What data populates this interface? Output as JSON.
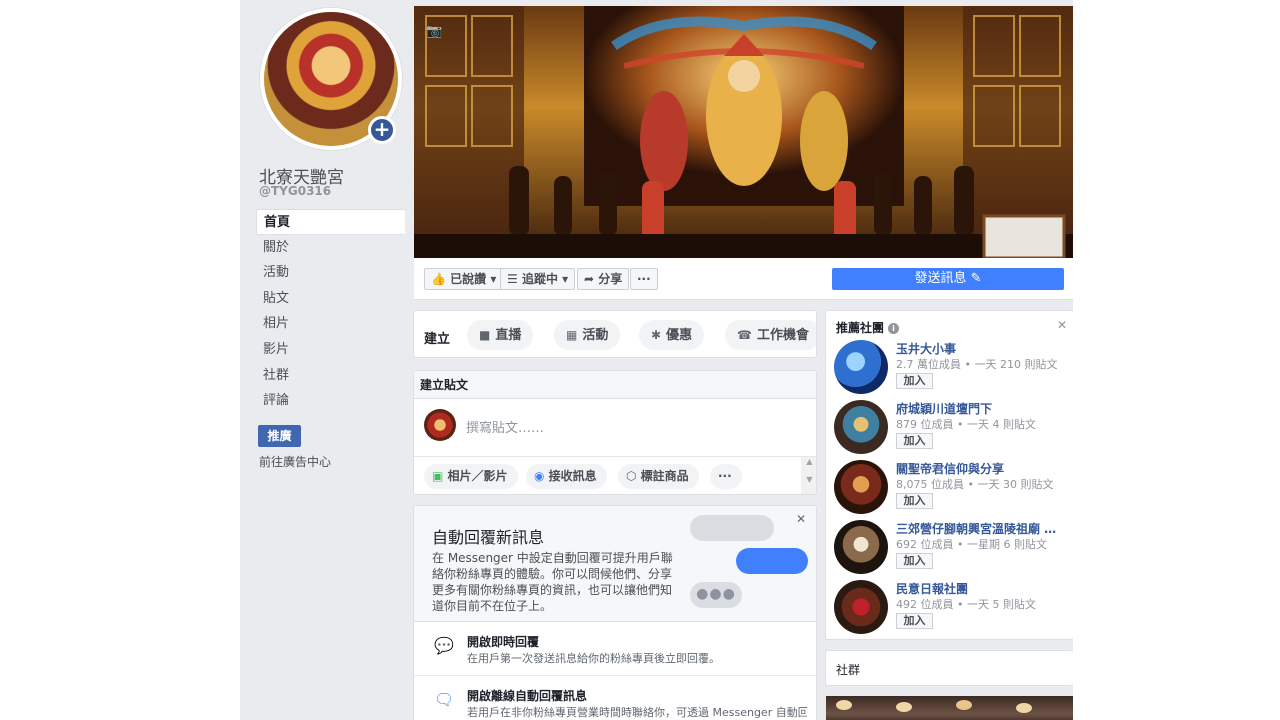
{
  "page": {
    "name": "北寮天艷宮",
    "handle": "@TYG0316"
  },
  "nav": {
    "items": [
      {
        "label": "首頁",
        "active": true
      },
      {
        "label": "關於"
      },
      {
        "label": "活動"
      },
      {
        "label": "貼文"
      },
      {
        "label": "相片"
      },
      {
        "label": "影片"
      },
      {
        "label": "社群"
      },
      {
        "label": "評論"
      }
    ],
    "promote_label": "推廣",
    "ads_center_label": "前往廣告中心"
  },
  "actions": {
    "liked_label": "已說讚",
    "following_label": "追蹤中",
    "share_label": "分享",
    "more_label": "···",
    "send_message_label": "發送訊息"
  },
  "create": {
    "label": "建立",
    "buttons": [
      "直播",
      "活動",
      "優惠",
      "工作機會"
    ]
  },
  "post": {
    "header": "建立貼文",
    "placeholder": "撰寫貼文……",
    "actions": [
      "相片／影片",
      "接收訊息",
      "標註商品",
      "···"
    ]
  },
  "auto_reply": {
    "title": "自動回覆新訊息",
    "description": "在 Messenger 中設定自動回覆可提升用戶聯絡你粉絲專頁的體驗。你可以問候他們、分享更多有關你粉絲專頁的資訊，也可以讓他們知道你目前不在位子上。",
    "typing_dots": "●●●",
    "rows": [
      {
        "title": "開啟即時回覆",
        "desc": "在用戶第一次發送訊息給你的粉絲專頁後立即回覆。"
      },
      {
        "title": "開啟離線自動回覆訊息",
        "desc": "若用戶在非你粉絲專頁營業時間時聯絡你，可透過 Messenger 自動回覆"
      }
    ]
  },
  "groups": {
    "title": "推薦社團",
    "join_label": "加入",
    "items": [
      {
        "name": "玉井大小事",
        "meta": "2.7 萬位成員 • 一天 210 則貼文"
      },
      {
        "name": "府城穎川道壇門下",
        "meta": "879 位成員 • 一天 4 則貼文"
      },
      {
        "name": "關聖帝君信仰與分享",
        "meta": "8,075 位成員 • 一天 30 則貼文"
      },
      {
        "name": "三郊營仔腳朝興宮溫陵祖廟 …",
        "meta": "692 位成員 • 一星期 6 則貼文"
      },
      {
        "name": "民意日報社團",
        "meta": "492 位成員 • 一天 5 則貼文"
      }
    ]
  },
  "community": {
    "title": "社群"
  },
  "colors": {
    "accent": "#4267b2",
    "messenger_blue": "#4080ff",
    "link": "#365899",
    "background": "#e9ebee"
  }
}
